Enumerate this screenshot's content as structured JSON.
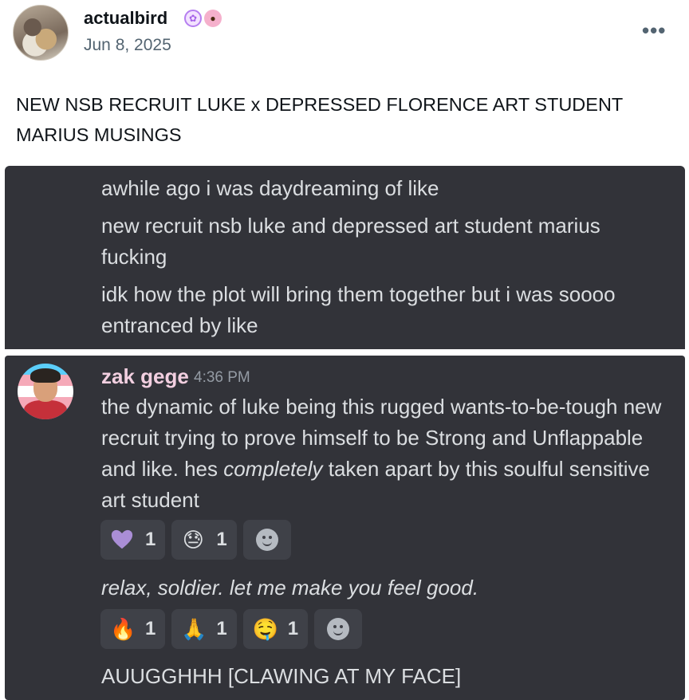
{
  "header": {
    "username": "actualbird",
    "date": "Jun 8, 2025",
    "more_label": "•••",
    "badges": [
      "brain-badge-icon",
      "paw-badge-icon"
    ]
  },
  "post": {
    "text": "NEW NSB RECRUIT LUKE x DEPRESSED FLORENCE ART STUDENT MARIUS MUSINGS"
  },
  "chat": {
    "panel1": {
      "lines": [
        "awhile ago i was daydreaming of like",
        "new recruit nsb luke and depressed art student marius fucking",
        "idk how the plot will bring them together but i was soooo entranced by like"
      ]
    },
    "panel2": {
      "author": "zak gege",
      "time": "4:36 PM",
      "message_pre": "the dynamic of luke being this rugged wants-to-be-tough new recruit trying to prove himself to be Strong and Unflappable and like. hes ",
      "message_em": "completely",
      "message_post": " taken apart by this soulful sensitive art student",
      "reactions1": [
        {
          "icon": "purple-heart-icon",
          "count": "1"
        },
        {
          "icon": "sleepy-face-icon",
          "emoji": "😓",
          "count": "1"
        }
      ],
      "quote": "relax, soldier. let me make you feel good.",
      "reactions2": [
        {
          "icon": "fire-icon",
          "emoji": "🔥",
          "count": "1"
        },
        {
          "icon": "praying-hands-icon",
          "emoji": "🙏",
          "count": "1"
        },
        {
          "icon": "drooling-face-icon",
          "emoji": "🤤",
          "count": "1"
        }
      ],
      "last_line": "AUUGGHHH [CLAWING AT MY FACE]"
    }
  }
}
